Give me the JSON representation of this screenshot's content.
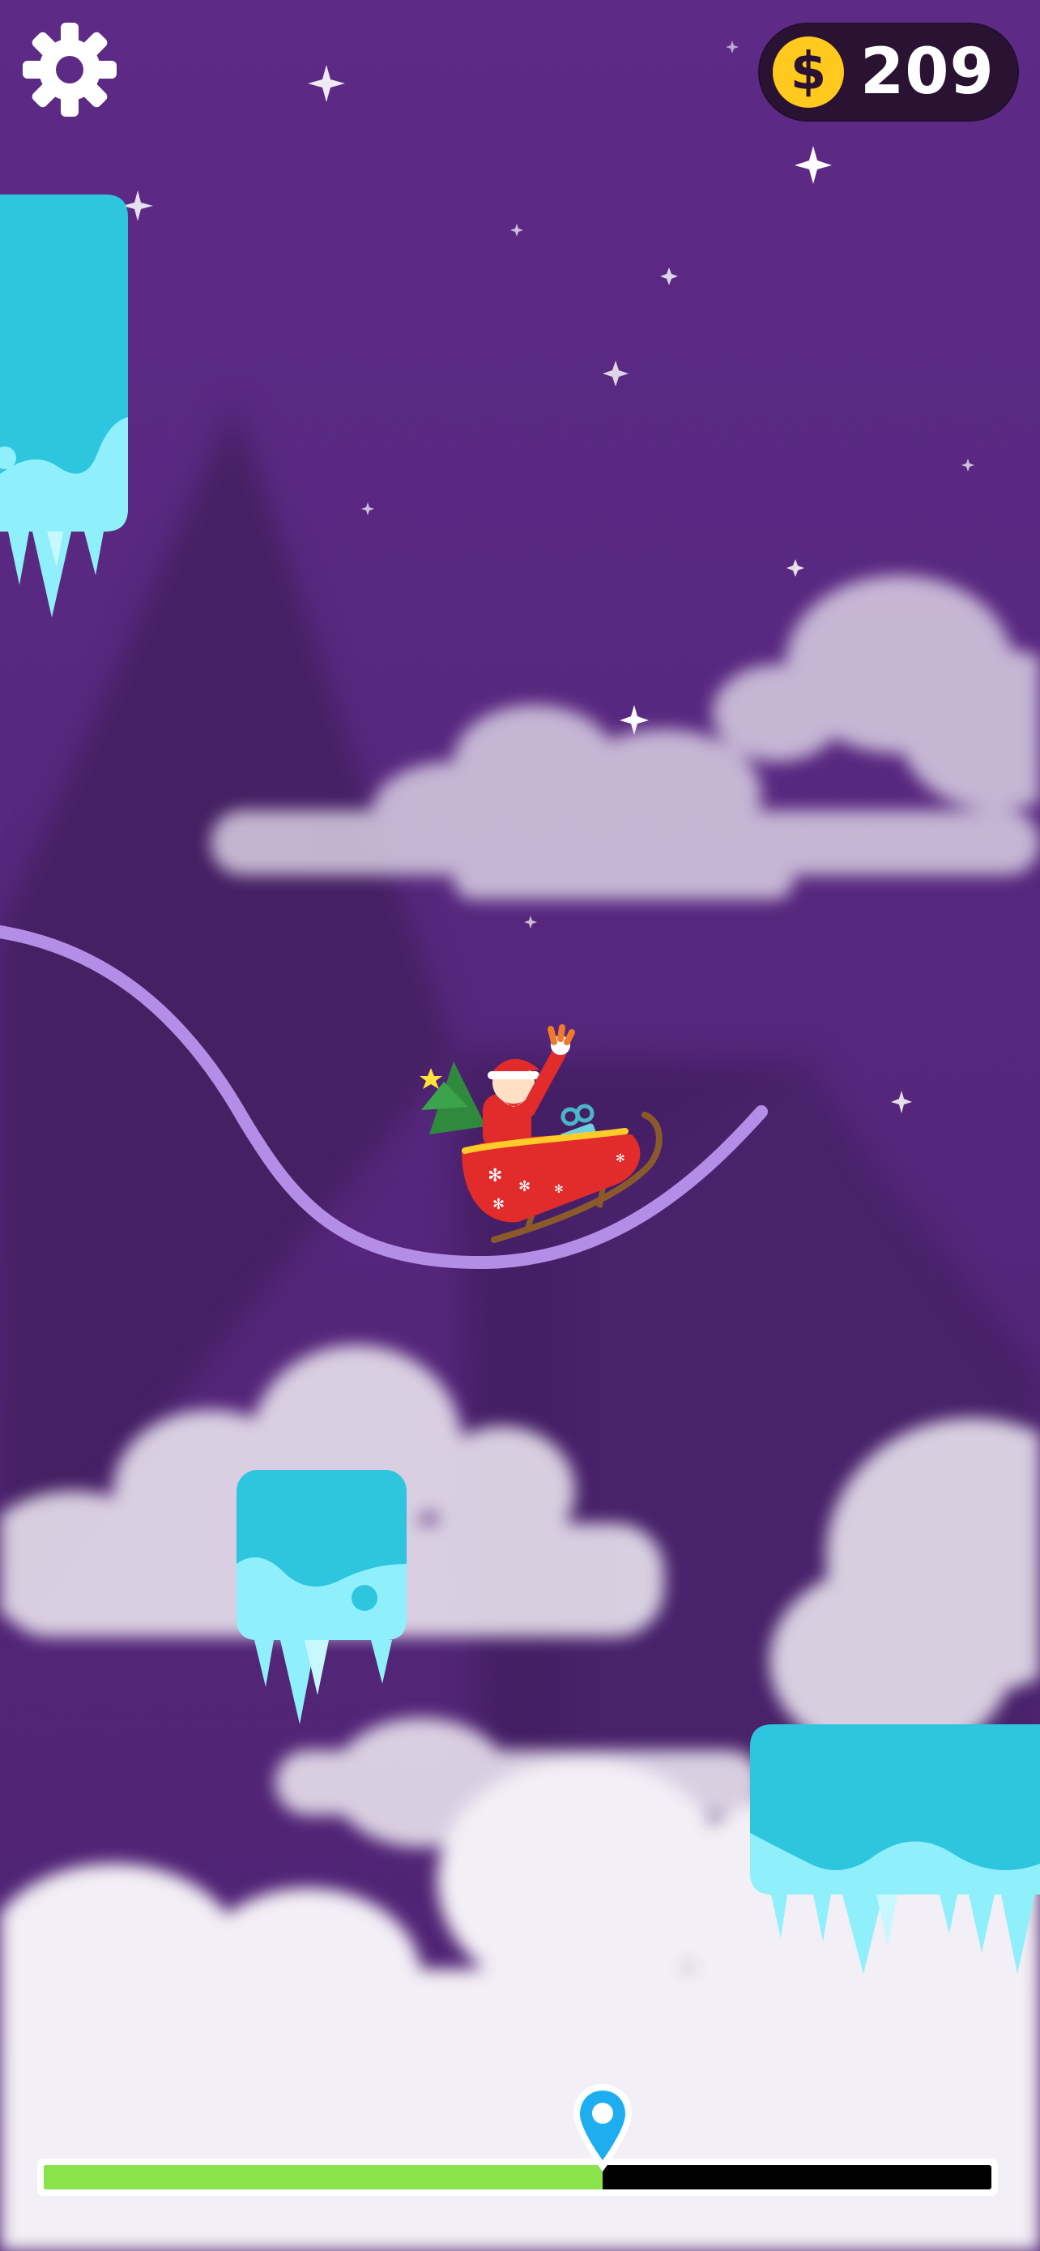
{
  "hud": {
    "settings_icon": "gear-icon",
    "coin_icon": "dollar-coin-icon",
    "coin_symbol": "$",
    "coin_count": "209"
  },
  "level_progress": {
    "fraction": 0.59,
    "marker_icon": "location-pin-icon"
  },
  "colors": {
    "sky": "#5a2881",
    "mountain": "#452063",
    "ice_top": "#2ec6df",
    "ice_bottom": "#8ff0fb",
    "track": "#b48ee6",
    "coin_gold": "#ffc91e",
    "progress_fill": "#8ae34a",
    "pin_blue": "#1eaef0"
  },
  "player": {
    "character": "santa-sleigh"
  }
}
